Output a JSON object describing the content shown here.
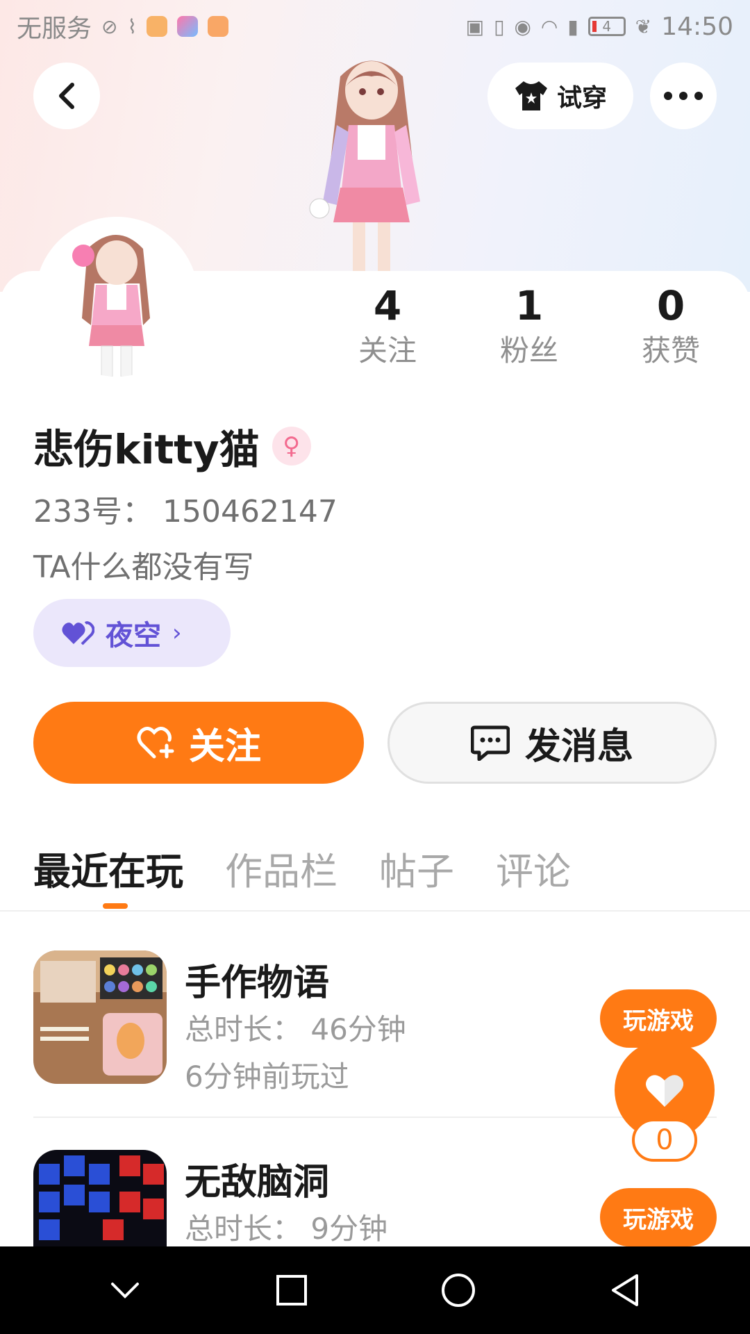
{
  "status_bar": {
    "carrier": "无服务",
    "battery": "4",
    "time": "14:50"
  },
  "header": {
    "tryon_label": "试穿"
  },
  "profile": {
    "following_count": "4",
    "following_label": "关注",
    "fans_count": "1",
    "fans_label": "粉丝",
    "likes_count": "0",
    "likes_label": "获赞",
    "name": "悲伤kitty猫",
    "gender_symbol": "♀",
    "uid": "233号：  150462147",
    "bio": "TA什么都没有写",
    "badge_label": "夜空"
  },
  "actions": {
    "follow_label": "关注",
    "message_label": "发消息"
  },
  "tabs": [
    {
      "label": "最近在玩"
    },
    {
      "label": "作品栏"
    },
    {
      "label": "帖子"
    },
    {
      "label": "评论"
    }
  ],
  "games": [
    {
      "title": "手作物语",
      "duration": "总时长：  46分钟",
      "last_played": "6分钟前玩过",
      "play_label": "玩游戏"
    },
    {
      "title": "无敌脑洞",
      "duration": "总时长：  9分钟",
      "play_label": "玩游戏"
    }
  ],
  "like_fab": {
    "count": "0"
  },
  "colors": {
    "accent": "#ff7a14",
    "badge_bg": "#ebe7fb",
    "badge_text": "#6252d6",
    "gender_bg": "#fde3ea"
  }
}
